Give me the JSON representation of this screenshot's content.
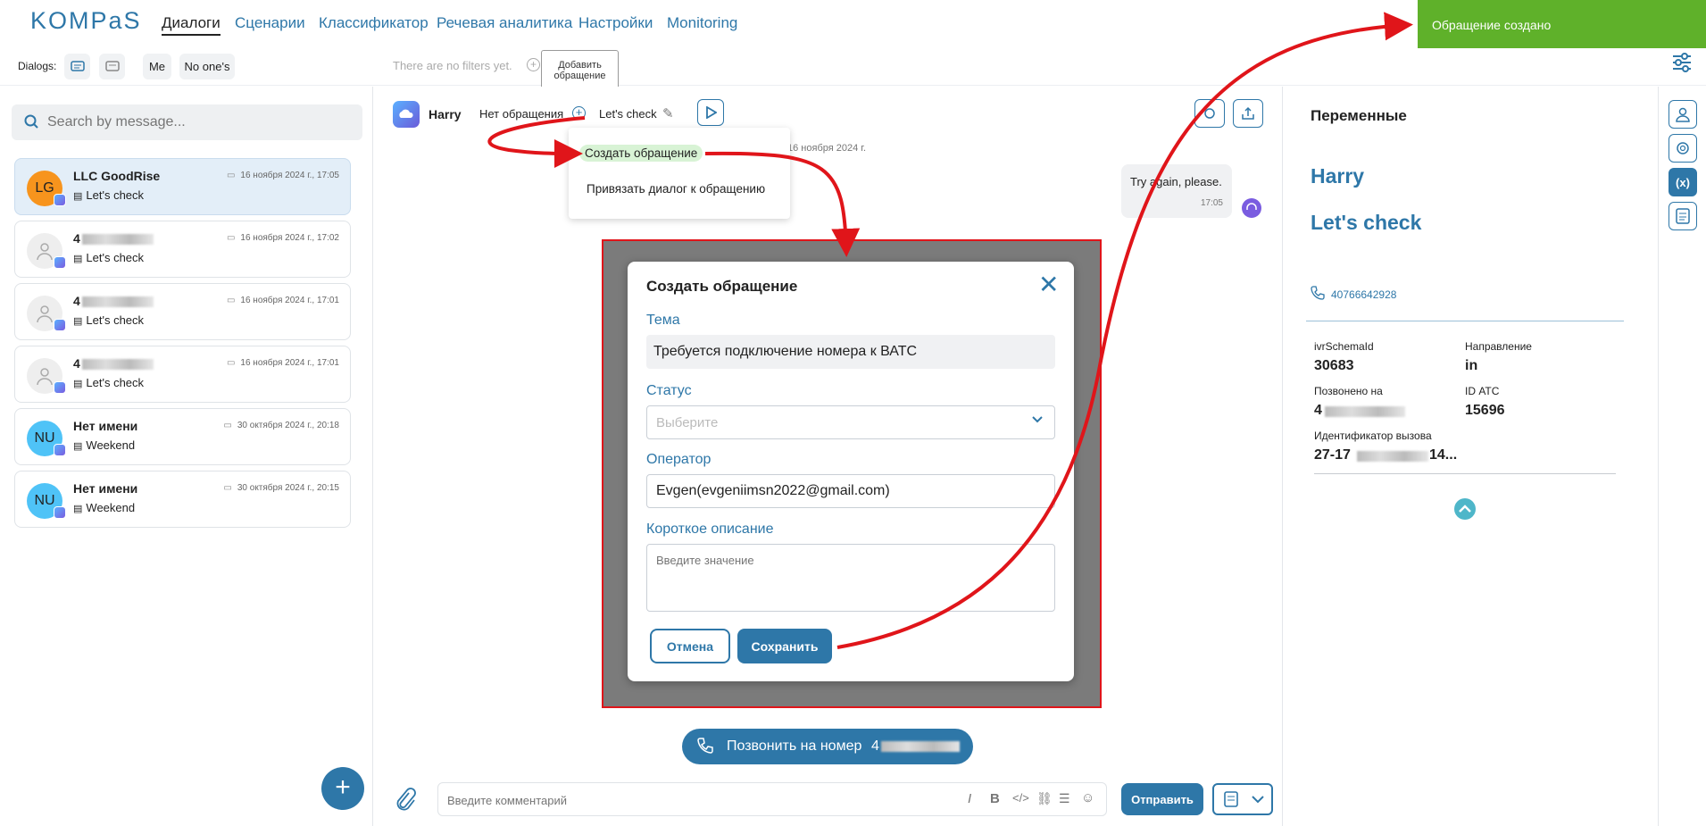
{
  "app": {
    "logo": "KOMPaS"
  },
  "nav": {
    "items": [
      "Диалоги",
      "Сценарии",
      "Классификатор",
      "Речевая аналитика",
      "Настройки",
      "Monitoring"
    ],
    "active": "Диалоги"
  },
  "filters": {
    "dialogs_label": "Dialogs:",
    "me": "Me",
    "no_ones": "No one's",
    "empty": "There are no filters yet."
  },
  "tooltip": {
    "line1": "Добавить",
    "line2": "обращение"
  },
  "search": {
    "placeholder": "Search by message..."
  },
  "conversations": [
    {
      "initials": "LG",
      "name": "LLC GoodRise",
      "subject": "Let's check",
      "date": "16 ноября 2024 г., 17:05",
      "avatar_color": "#f7941d"
    },
    {
      "initials": "",
      "name": "4",
      "subject": "Let's check",
      "date": "16 ноября 2024 г., 17:02",
      "avatar_color": "#eeeeee"
    },
    {
      "initials": "",
      "name": "4",
      "subject": "Let's check",
      "date": "16 ноября 2024 г., 17:01",
      "avatar_color": "#eeeeee"
    },
    {
      "initials": "",
      "name": "4",
      "subject": "Let's check",
      "date": "16 ноября 2024 г., 17:01",
      "avatar_color": "#eeeeee"
    },
    {
      "initials": "NU",
      "name": "Нет имени",
      "subject": "Weekend",
      "date": "30 октября 2024 г., 20:18",
      "avatar_color": "#4fc3f7"
    },
    {
      "initials": "NU",
      "name": "Нет имени",
      "subject": "Weekend",
      "date": "30 октября 2024 г., 20:15",
      "avatar_color": "#4fc3f7"
    }
  ],
  "chat": {
    "contact": "Harry",
    "no_ticket": "Нет обращения",
    "topic": "Let's check",
    "date_sep": "16 ноября 2024 г.",
    "message": {
      "text": "Try again, please.",
      "time": "17:05"
    },
    "call_btn": "Позвонить на номер",
    "call_number": "4",
    "comment_placeholder": "Введите комментарий",
    "send": "Отправить"
  },
  "dropdown": {
    "create": "Создать обращение",
    "link": "Привязать диалог к обращению"
  },
  "modal": {
    "title": "Создать обращение",
    "topic_label": "Тема",
    "topic_value": "Требуется подключение номера к ВАТС",
    "status_label": "Статус",
    "status_placeholder": "Выберите",
    "operator_label": "Оператор",
    "operator_value": "Evgen(evgeniimsn2022@gmail.com)",
    "desc_label": "Короткое описание",
    "desc_placeholder": "Введите значение",
    "cancel": "Отмена",
    "save": "Сохранить"
  },
  "vars": {
    "title": "Переменные",
    "name": "Harry",
    "topic": "Let's check",
    "phone": "40766642928",
    "ivr_label": "ivrSchemaId",
    "ivr_value": "30683",
    "dir_label": "Направление",
    "dir_value": "in",
    "called_label": "Позвонено на",
    "called_value": "4",
    "atc_label": "ID АТС",
    "atc_value": "15696",
    "callid_label": "Идентификатор вызова",
    "callid_start": "27-17",
    "callid_end": "14..."
  },
  "toast": "Обращение создано",
  "colors": {
    "accent": "#2e77a8",
    "toast": "#5fb12a",
    "highlight": "#e0151a"
  }
}
